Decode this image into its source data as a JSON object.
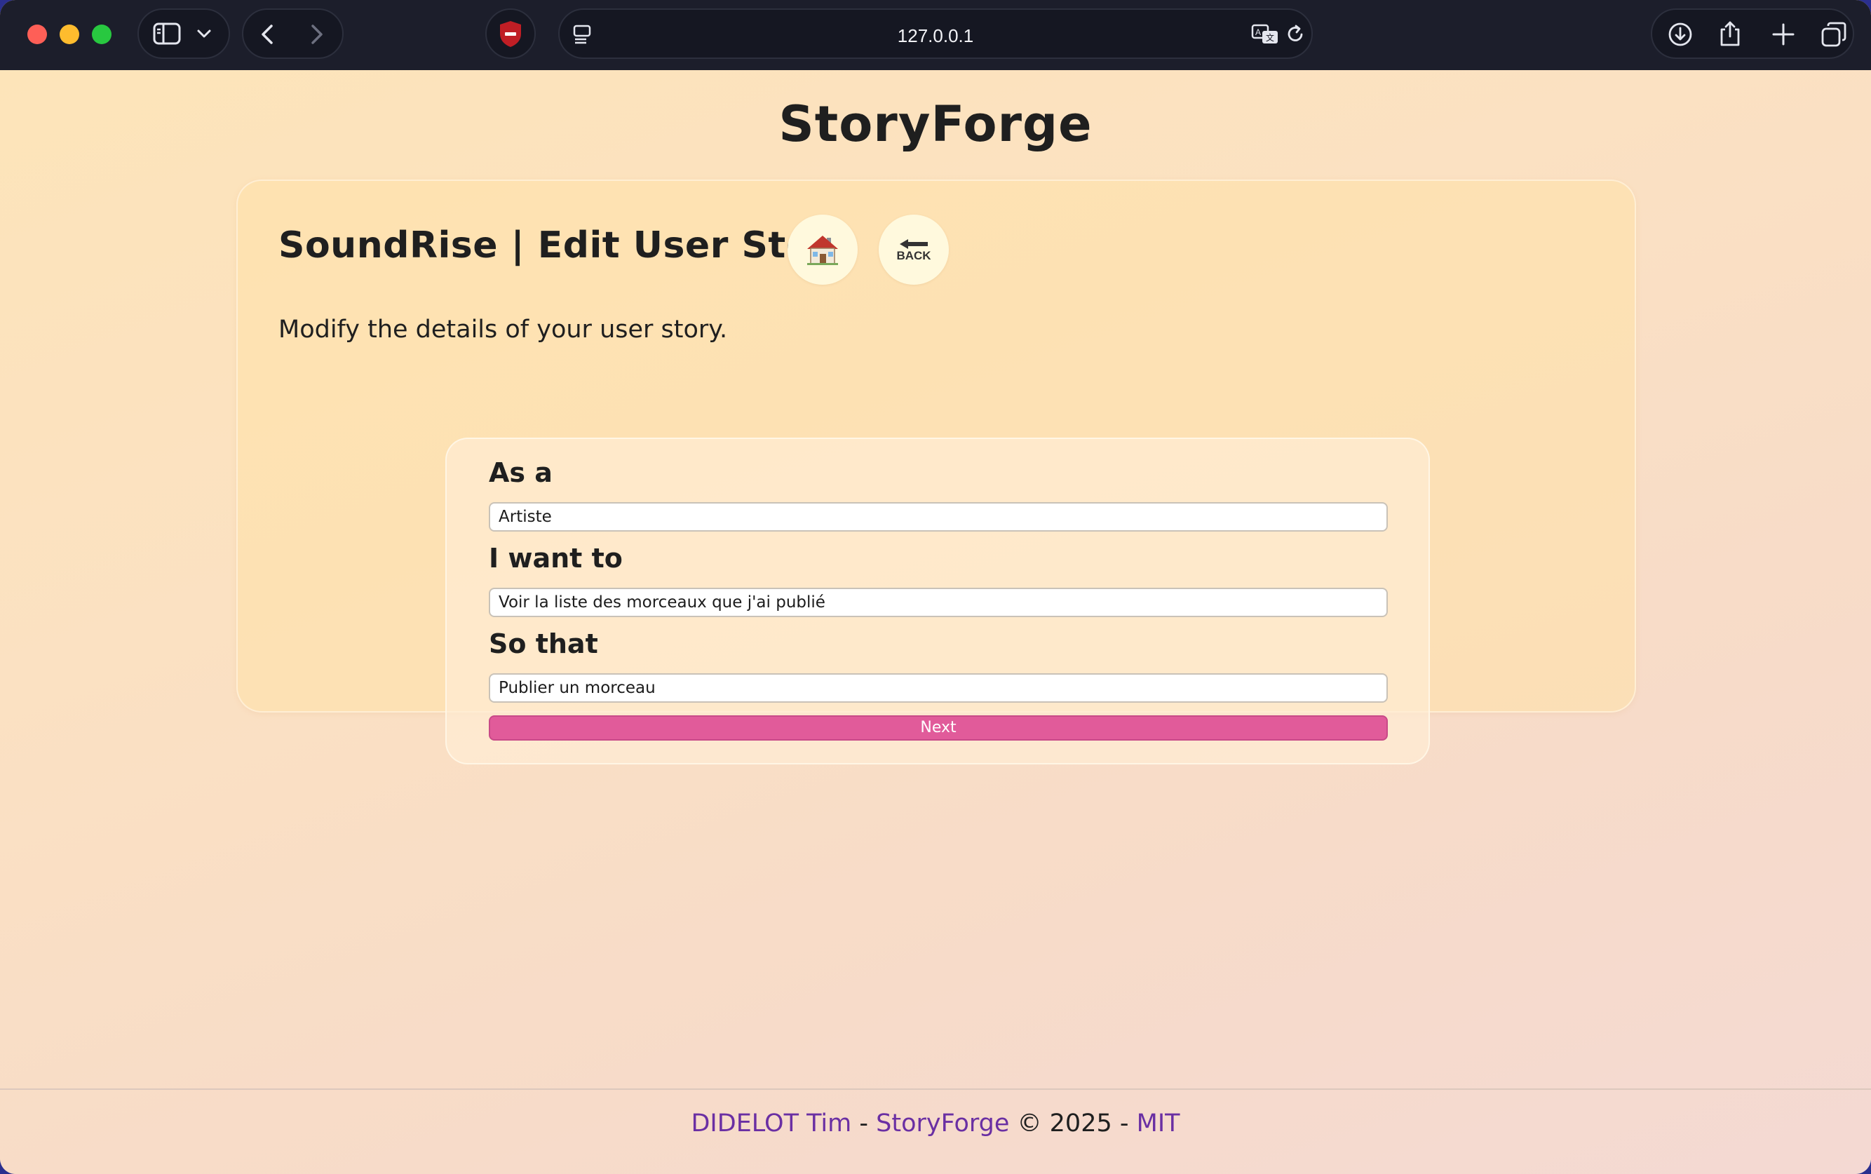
{
  "browser": {
    "url": "127.0.0.1"
  },
  "app": {
    "title": "StoryForge"
  },
  "card": {
    "heading": "SoundRise | Edit User Story",
    "home_icon": "house-emoji",
    "back_label": "BACK",
    "subtitle": "Modify the details of your user story."
  },
  "form": {
    "as_a_label": "As a",
    "as_a_value": "Artiste",
    "want_label": "I want to",
    "want_value": "Voir la liste des morceaux que j'ai publié",
    "so_that_label": "So that",
    "so_that_value": "Publier un morceau",
    "next_label": "Next"
  },
  "footer": {
    "author": "DIDELOT Tim",
    "sep1": " - ",
    "project": "StoryForge",
    "copyright": " © 2025 - ",
    "license": "MIT"
  },
  "colors": {
    "accent_button": "#e15b9a",
    "link": "#6a2fa3",
    "toolbar": "#1c1e2b"
  }
}
